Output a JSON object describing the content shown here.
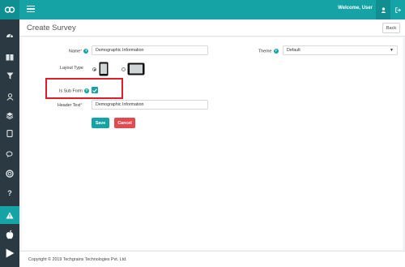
{
  "header": {
    "welcome_text": "Welcome, User",
    "user_icon": "user-icon",
    "logout_icon": "logout-icon"
  },
  "sidebar": {
    "items": [
      {
        "icon": "dashboard-icon"
      },
      {
        "icon": "book-icon"
      },
      {
        "icon": "filter-icon"
      },
      {
        "icon": "user-icon"
      },
      {
        "icon": "layers-icon"
      },
      {
        "icon": "tablet-icon"
      },
      {
        "icon": "comments-icon"
      },
      {
        "icon": "lifebuoy-icon"
      },
      {
        "icon": "question-icon",
        "label": "?"
      },
      {
        "icon": "warning-icon",
        "active": true
      },
      {
        "icon": "apple-icon"
      },
      {
        "icon": "play-store-icon"
      }
    ]
  },
  "page": {
    "title": "Create Survey",
    "back_label": "Back"
  },
  "form": {
    "name_label": "Name",
    "name_required": "*",
    "name_value": "Demographic Information",
    "theme_label": "Theme",
    "theme_value": "Default",
    "layout_label": "Layout Type",
    "layout_selected": "portrait",
    "subform_label": "Is Sub Form",
    "subform_checked": true,
    "header_label": "Header Text",
    "header_required": "*",
    "header_value": "Demographic Information",
    "help_glyph": "?",
    "save_label": "Save",
    "cancel_label": "Cancel"
  },
  "footer": {
    "copyright": "Copyright © 2019 Techgrains Technologies Pvt. Ltd."
  },
  "colors": {
    "accent": "#16a3a5",
    "sidebar": "#2b3a42",
    "danger": "#e04b52",
    "highlight": "#e01e2a"
  }
}
